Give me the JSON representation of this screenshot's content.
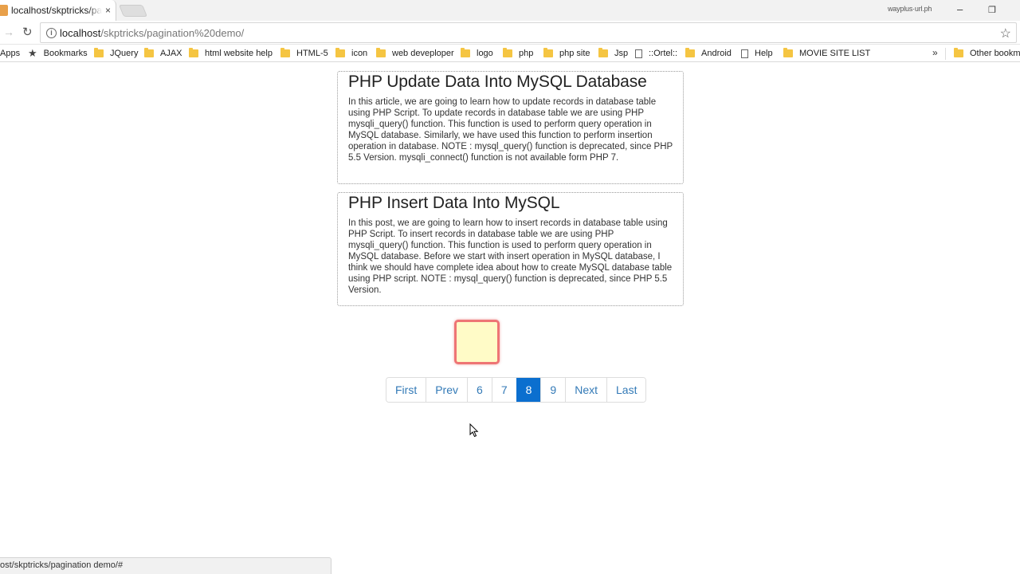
{
  "browser": {
    "tab_title": "localhost/skptricks/pagin",
    "tab_close": "×",
    "profile_name": "wayplus·url.ph",
    "window_controls": {
      "minimize": "–",
      "restore": "❐"
    },
    "nav_forward": "→",
    "nav_reload": "↻",
    "url_host": "localhost",
    "url_path": "/skptricks/pagination%20demo/",
    "bookmark_star": "☆"
  },
  "bookmarks": {
    "items": [
      {
        "label": "Apps",
        "icon": "apps-icon"
      },
      {
        "label": "Bookmarks",
        "icon": "star-icon"
      },
      {
        "label": "JQuery",
        "icon": "folder-icon"
      },
      {
        "label": "AJAX",
        "icon": "folder-icon"
      },
      {
        "label": "html website help",
        "icon": "folder-icon"
      },
      {
        "label": "HTML-5",
        "icon": "folder-icon"
      },
      {
        "label": "icon",
        "icon": "folder-icon"
      },
      {
        "label": "web deveploper",
        "icon": "folder-icon"
      },
      {
        "label": "logo",
        "icon": "folder-icon"
      },
      {
        "label": "php",
        "icon": "folder-icon"
      },
      {
        "label": "php site",
        "icon": "folder-icon"
      },
      {
        "label": "Jsp",
        "icon": "folder-icon"
      },
      {
        "label": "::Ortel::",
        "icon": "page-icon"
      },
      {
        "label": "Android",
        "icon": "folder-icon"
      },
      {
        "label": "Help",
        "icon": "page-icon"
      },
      {
        "label": "MOVIE SITE LIST",
        "icon": "folder-icon"
      }
    ],
    "overflow": "»",
    "other": "Other bookmarks"
  },
  "articles": [
    {
      "title": "PHP Update Data Into MySQL Database",
      "body": "In this article, we are going to learn how to update records in database table using PHP Script. To update records in database table we are using PHP mysqli_query() function. This function is used to perform query operation in MySQL database. Similarly, we have used this function to perform insertion operation in database. NOTE : mysql_query() function is deprecated, since PHP 5.5 Version. mysqli_connect() function is not available form PHP 7."
    },
    {
      "title": "PHP Insert Data Into MySQL",
      "body": "In this post, we are going to learn how to insert records in database table using PHP Script. To insert records in database table we are using PHP mysqli_query() function. This function is used to perform query operation in MySQL database. Before we start with insert operation in MySQL database, I think we should have complete idea about how to create MySQL database table using PHP script. NOTE : mysql_query() function is deprecated, since PHP 5.5 Version."
    }
  ],
  "pagination": {
    "items": [
      "First",
      "Prev",
      "6",
      "7",
      "8",
      "9",
      "Next",
      "Last"
    ],
    "active": "8"
  },
  "status_url": "ost/skptricks/pagination demo/#",
  "colors": {
    "link": "#337ab7",
    "active_page": "#0b6fcf",
    "loader_border": "#ee7575",
    "loader_fill": "#fffbc7"
  }
}
